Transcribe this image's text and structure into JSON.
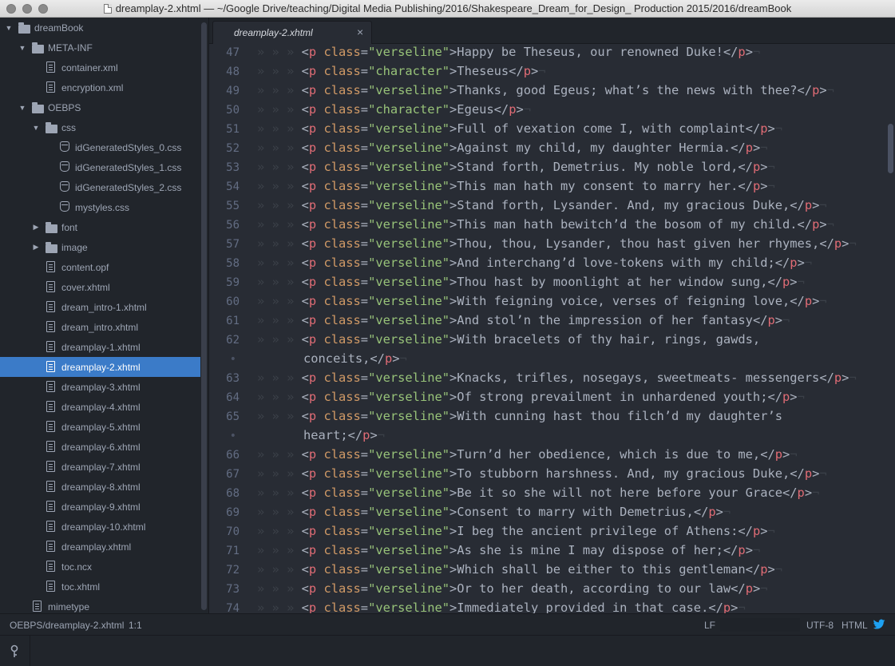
{
  "window": {
    "title": "dreamplay-2.xhtml — ~/Google Drive/teaching/Digital Media Publishing/2016/Shakespeare_Dream_for_Design_ Production 2015/2016/dreamBook"
  },
  "tree": [
    {
      "label": "dreamBook",
      "type": "folder",
      "depth": 0,
      "expanded": true
    },
    {
      "label": "META-INF",
      "type": "folder",
      "depth": 1,
      "expanded": true
    },
    {
      "label": "container.xml",
      "type": "file",
      "depth": 2
    },
    {
      "label": "encryption.xml",
      "type": "file",
      "depth": 2
    },
    {
      "label": "OEBPS",
      "type": "folder",
      "depth": 1,
      "expanded": true
    },
    {
      "label": "css",
      "type": "folder",
      "depth": 2,
      "expanded": true
    },
    {
      "label": "idGeneratedStyles_0.css",
      "type": "css",
      "depth": 3
    },
    {
      "label": "idGeneratedStyles_1.css",
      "type": "css",
      "depth": 3
    },
    {
      "label": "idGeneratedStyles_2.css",
      "type": "css",
      "depth": 3
    },
    {
      "label": "mystyles.css",
      "type": "css",
      "depth": 3
    },
    {
      "label": "font",
      "type": "folder",
      "depth": 2,
      "expanded": false
    },
    {
      "label": "image",
      "type": "folder",
      "depth": 2,
      "expanded": false
    },
    {
      "label": "content.opf",
      "type": "file",
      "depth": 2
    },
    {
      "label": "cover.xhtml",
      "type": "file",
      "depth": 2
    },
    {
      "label": "dream_intro-1.xhtml",
      "type": "file",
      "depth": 2
    },
    {
      "label": "dream_intro.xhtml",
      "type": "file",
      "depth": 2
    },
    {
      "label": "dreamplay-1.xhtml",
      "type": "file",
      "depth": 2
    },
    {
      "label": "dreamplay-2.xhtml",
      "type": "file",
      "depth": 2,
      "selected": true
    },
    {
      "label": "dreamplay-3.xhtml",
      "type": "file",
      "depth": 2
    },
    {
      "label": "dreamplay-4.xhtml",
      "type": "file",
      "depth": 2
    },
    {
      "label": "dreamplay-5.xhtml",
      "type": "file",
      "depth": 2
    },
    {
      "label": "dreamplay-6.xhtml",
      "type": "file",
      "depth": 2
    },
    {
      "label": "dreamplay-7.xhtml",
      "type": "file",
      "depth": 2
    },
    {
      "label": "dreamplay-8.xhtml",
      "type": "file",
      "depth": 2
    },
    {
      "label": "dreamplay-9.xhtml",
      "type": "file",
      "depth": 2
    },
    {
      "label": "dreamplay-10.xhtml",
      "type": "file",
      "depth": 2
    },
    {
      "label": "dreamplay.xhtml",
      "type": "file",
      "depth": 2
    },
    {
      "label": "toc.ncx",
      "type": "file",
      "depth": 2
    },
    {
      "label": "toc.xhtml",
      "type": "file",
      "depth": 2
    },
    {
      "label": "mimetype",
      "type": "file",
      "depth": 1
    }
  ],
  "tab": {
    "title": "dreamplay-2.xhtml",
    "close": "×"
  },
  "indent_glyphs": "» » »",
  "newline_glyph": "¬",
  "wrap_marker": "•",
  "tag_name": "p",
  "attr_name": "class",
  "code_lines": [
    {
      "n": "47",
      "cls": "verseline",
      "text": "Happy be Theseus, our renowned Duke!"
    },
    {
      "n": "48",
      "cls": "character",
      "text": "Theseus"
    },
    {
      "n": "49",
      "cls": "verseline",
      "text": "Thanks, good Egeus; what’s the news with thee?"
    },
    {
      "n": "50",
      "cls": "character",
      "text": "Egeus"
    },
    {
      "n": "51",
      "cls": "verseline",
      "text": "Full of vexation come I, with complaint"
    },
    {
      "n": "52",
      "cls": "verseline",
      "text": "Against my child, my daughter Hermia."
    },
    {
      "n": "53",
      "cls": "verseline",
      "text": "Stand forth, Demetrius. My noble lord,"
    },
    {
      "n": "54",
      "cls": "verseline",
      "text": "This man hath my consent to marry her."
    },
    {
      "n": "55",
      "cls": "verseline",
      "text": "Stand forth, Lysander. And, my gracious Duke,"
    },
    {
      "n": "56",
      "cls": "verseline",
      "text": "This man hath bewitch’d the bosom of my child."
    },
    {
      "n": "57",
      "cls": "verseline",
      "text": "Thou, thou, Lysander, thou hast given her rhymes,"
    },
    {
      "n": "58",
      "cls": "verseline",
      "text": "And interchang’d love-tokens with my child;"
    },
    {
      "n": "59",
      "cls": "verseline",
      "text": "Thou hast by moonlight at her window sung,"
    },
    {
      "n": "60",
      "cls": "verseline",
      "text": "With feigning voice, verses of feigning love,"
    },
    {
      "n": "61",
      "cls": "verseline",
      "text": "And stol’n the impression of her fantasy"
    },
    {
      "n": "62",
      "cls": "verseline",
      "text": "With bracelets of thy hair, rings, gawds,",
      "wrap": "conceits,"
    },
    {
      "n": "63",
      "cls": "verseline",
      "text": "Knacks, trifles, nosegays, sweetmeats- messengers"
    },
    {
      "n": "64",
      "cls": "verseline",
      "text": "Of strong prevailment in unhardened youth;"
    },
    {
      "n": "65",
      "cls": "verseline",
      "text": "With cunning hast thou filch’d my daughter’s",
      "wrap": "heart;"
    },
    {
      "n": "66",
      "cls": "verseline",
      "text": "Turn’d her obedience, which is due to me,"
    },
    {
      "n": "67",
      "cls": "verseline",
      "text": "To stubborn harshness. And, my gracious Duke,"
    },
    {
      "n": "68",
      "cls": "verseline",
      "text": "Be it so she will not here before your Grace"
    },
    {
      "n": "69",
      "cls": "verseline",
      "text": "Consent to marry with Demetrius,"
    },
    {
      "n": "70",
      "cls": "verseline",
      "text": "I beg the ancient privilege of Athens:"
    },
    {
      "n": "71",
      "cls": "verseline",
      "text": "As she is mine I may dispose of her;"
    },
    {
      "n": "72",
      "cls": "verseline",
      "text": "Which shall be either to this gentleman"
    },
    {
      "n": "73",
      "cls": "verseline",
      "text": "Or to her death, according to our law"
    },
    {
      "n": "74",
      "cls": "verseline",
      "text": "Immediately provided in that case."
    }
  ],
  "status": {
    "path": "OEBPS/dreamplay-2.xhtml",
    "cursor": "1:1",
    "line_ending": "LF",
    "encoding": "UTF-8",
    "grammar": "HTML"
  },
  "colors": {
    "selection": "#3b7bc8",
    "tag": "#e06c75",
    "attribute": "#d19a66",
    "string": "#98c379",
    "bird": "#1da1f2"
  }
}
